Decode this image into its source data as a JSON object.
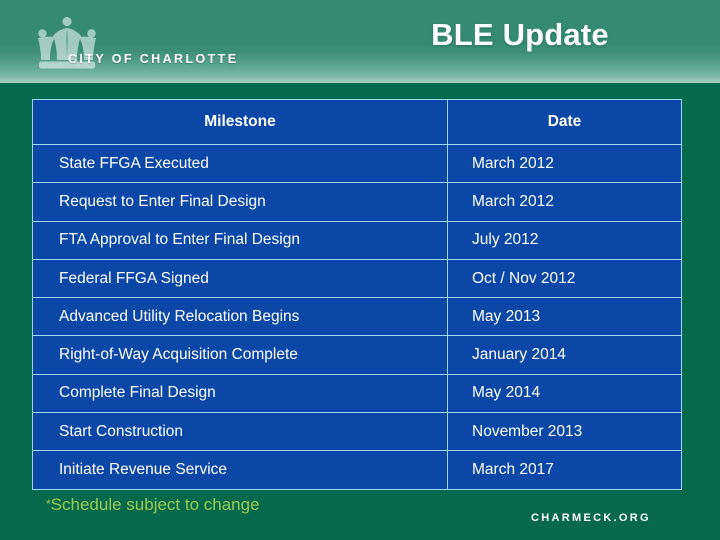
{
  "header": {
    "logo_wordmark": "CITY OF CHARLOTTE",
    "crown_icon": "crown-icon",
    "title": "BLE Update"
  },
  "table": {
    "columns": [
      "Milestone",
      "Date"
    ],
    "rows": [
      {
        "milestone": "State FFGA Executed",
        "date": "March 2012"
      },
      {
        "milestone": "Request to Enter Final Design",
        "date": "March 2012"
      },
      {
        "milestone": "FTA Approval to Enter Final Design",
        "date": "July 2012"
      },
      {
        "milestone": "Federal FFGA Signed",
        "date": "Oct / Nov 2012"
      },
      {
        "milestone": "Advanced Utility Relocation Begins",
        "date": "May 2013"
      },
      {
        "milestone": "Right-of-Way Acquisition Complete",
        "date": "January 2014"
      },
      {
        "milestone": "Complete Final Design",
        "date": "May 2014"
      },
      {
        "milestone": "Start Construction",
        "date": "November 2013"
      },
      {
        "milestone": "Initiate Revenue Service",
        "date": "March 2017"
      }
    ]
  },
  "footer": {
    "asterisk": "*",
    "note": "Schedule subject to change",
    "site_wordmark": "CHARMECK.ORG"
  },
  "colors": {
    "table_fill": "#0b47a6",
    "table_border": "#9fd8ec",
    "background_green": "#06694b",
    "header_green_top": "#348b71",
    "header_green_bottom": "#8cc0b0",
    "footnote_green": "#9ccc4f",
    "text_white": "#ffffff"
  }
}
